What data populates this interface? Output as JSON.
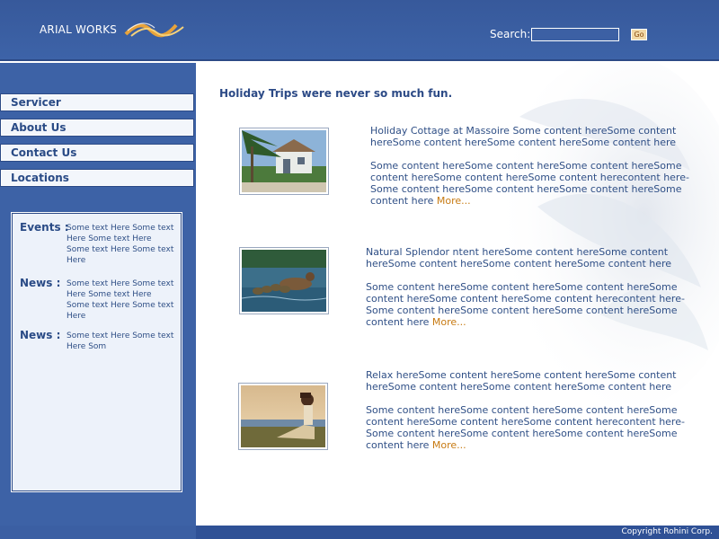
{
  "header": {
    "brand": "ARIAL WORKS",
    "logo_icon": "wave-logo-icon",
    "search_label": "Search:",
    "search_value": "",
    "go_label": "Go"
  },
  "sidebar": {
    "nav": [
      {
        "label": "Servicer"
      },
      {
        "label": "About Us"
      },
      {
        "label": "Contact Us"
      },
      {
        "label": "Locations"
      }
    ],
    "news": [
      {
        "label": "Events :",
        "text": "Some text Here Some text Here Some text Here Some text Here Some text Here"
      },
      {
        "label": "News :",
        "text": "Some text Here Some text Here Some text Here Some text Here Some text Here"
      },
      {
        "label": "News :",
        "text": "Some text Here Some text Here Som"
      }
    ]
  },
  "main": {
    "headline": "Holiday Trips  were never so much fun.",
    "items": [
      {
        "image": "beach-cottage-photo",
        "intro": "Holiday Cottage at Massoire Some content hereSome content hereSome content hereSome content hereSome content here",
        "body": "Some content hereSome content hereSome content hereSome content hereSome content hereSome content herecontent here-Some content hereSome content hereSome content hereSome content here ",
        "more": "More..."
      },
      {
        "image": "ducks-on-water-photo",
        "intro": "Natural Splendor ntent hereSome content hereSome content hereSome content hereSome content hereSome content here",
        "body": "Some content hereSome content hereSome content hereSome content hereSome content hereSome content herecontent here-Some content hereSome content hereSome content hereSome content here  ",
        "more": "More..."
      },
      {
        "image": "woman-relaxing-photo",
        "intro": "Relax hereSome content hereSome content hereSome content hereSome content hereSome content hereSome content here",
        "body": "Some content hereSome content hereSome content hereSome content hereSome content hereSome content herecontent here-Some content hereSome content hereSome content hereSome content here  ",
        "more": "More..."
      }
    ]
  },
  "footer": {
    "copyright": "Copyright Rohini Corp."
  },
  "colors": {
    "header_blue": "#3d63a8",
    "text_blue": "#2c4a86",
    "link_orange": "#c77a12"
  }
}
